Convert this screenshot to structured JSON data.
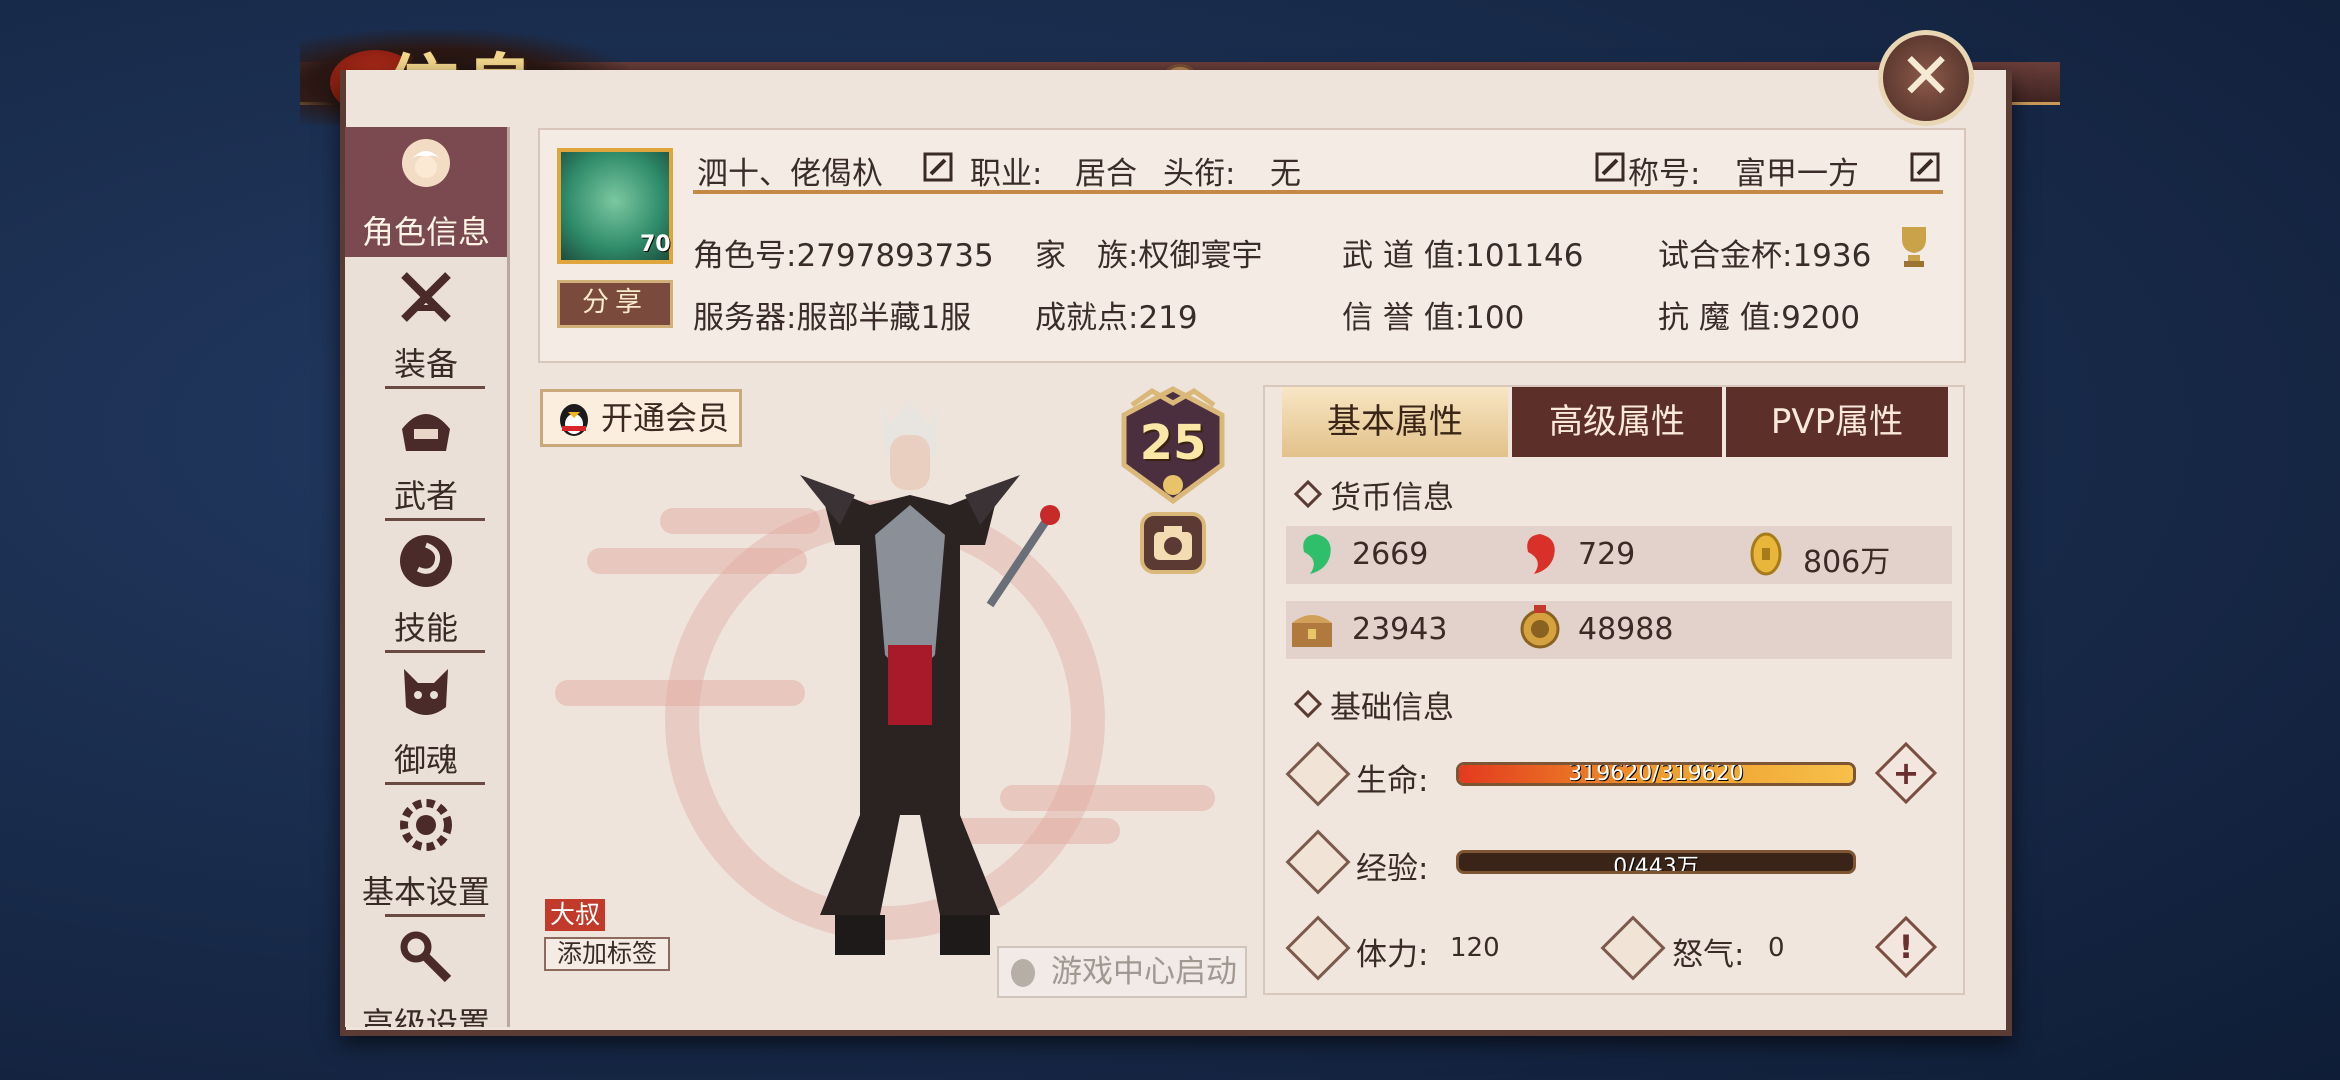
{
  "title": "信息",
  "sidebar": {
    "items": [
      {
        "label": "角色信息",
        "icon": "character-icon",
        "active": true
      },
      {
        "label": "装备",
        "icon": "crossed-swords-icon"
      },
      {
        "label": "武者",
        "icon": "samurai-helmet-icon"
      },
      {
        "label": "技能",
        "icon": "skill-swirl-icon"
      },
      {
        "label": "御魂",
        "icon": "spirit-fox-icon"
      },
      {
        "label": "基本设置",
        "icon": "gear-icon"
      },
      {
        "label": "高级设置",
        "icon": "wrench-icon"
      }
    ]
  },
  "profile": {
    "name": "泗十、佬偈杁",
    "avatar_level": "70",
    "job_label": "职业:",
    "job_value": "居合",
    "rank_label": "头衔:",
    "rank_value": "无",
    "nick_label": "称号:",
    "nick_value": "富甲一方",
    "share": "分享",
    "role_id": "角色号:2797893735",
    "clan": "家　族:权御寰宇",
    "wudao": "武 道 值:101146",
    "trial_cup": "试合金杯:1936",
    "server": "服务器:服部半藏1服",
    "achievement": "成就点:219",
    "honor": "信 誉 值:100",
    "kangmo": "抗 魔 值:9200"
  },
  "character": {
    "vip_button": "开通会员",
    "level": "25",
    "tag": "大叔",
    "add_tag": "添加标签",
    "game_center": "游戏中心启动"
  },
  "tabs": [
    "基本属性",
    "高级属性",
    "PVP属性"
  ],
  "currency": {
    "title": "货币信息",
    "items": [
      {
        "icon": "green-magatama-icon",
        "value": "2669"
      },
      {
        "icon": "red-magatama-icon",
        "value": "729"
      },
      {
        "icon": "gold-koban-icon",
        "value": "806万"
      },
      {
        "icon": "treasure-chest-icon",
        "value": "23943"
      },
      {
        "icon": "gold-medal-icon",
        "value": "48988"
      }
    ]
  },
  "basic": {
    "title": "基础信息",
    "hp_label": "生命:",
    "hp_text": "319620/319620",
    "hp_fraction": 1.0,
    "exp_label": "经验:",
    "exp_text": "0/443万",
    "exp_fraction": 0.0,
    "stamina_label": "体力:",
    "stamina_value": "120",
    "rage_label": "怒气:",
    "rage_value": "0"
  },
  "colors": {
    "panel": "#efe4dc",
    "frame": "#5a3c34",
    "accent_gold": "#c48a45",
    "active_tab": "#e2c18a"
  }
}
